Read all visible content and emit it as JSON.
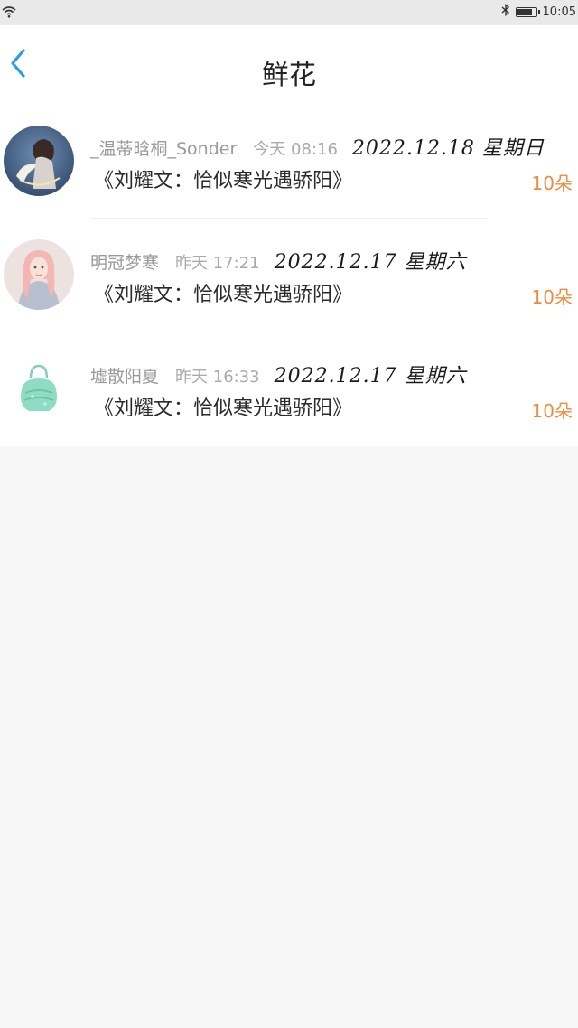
{
  "status_bar": {
    "time": "10:05",
    "icons": [
      "wifi-icon",
      "bluetooth-icon",
      "battery-icon"
    ]
  },
  "header": {
    "title": "鲜花",
    "back_icon": "chevron-left-icon",
    "accent_color": "#2a9ee8"
  },
  "gifts": [
    {
      "sender": "_温蒂晗桐_Sonder",
      "time": "今天 08:16",
      "date_stamp": "2022.12.18 星期日",
      "title": "《刘耀文：恰似寒光遇骄阳》",
      "count": "10朵"
    },
    {
      "sender": "明冠梦寒",
      "time": "昨天 17:21",
      "date_stamp": "2022.12.17 星期六",
      "title": "《刘耀文：恰似寒光遇骄阳》",
      "count": "10朵"
    },
    {
      "sender": "墟散阳夏",
      "time": "昨天 16:33",
      "date_stamp": "2022.12.17 星期六",
      "title": "《刘耀文：恰似寒光遇骄阳》",
      "count": "10朵"
    }
  ],
  "colors": {
    "count_color": "#f08a3c",
    "background": "#f7f6f7"
  }
}
